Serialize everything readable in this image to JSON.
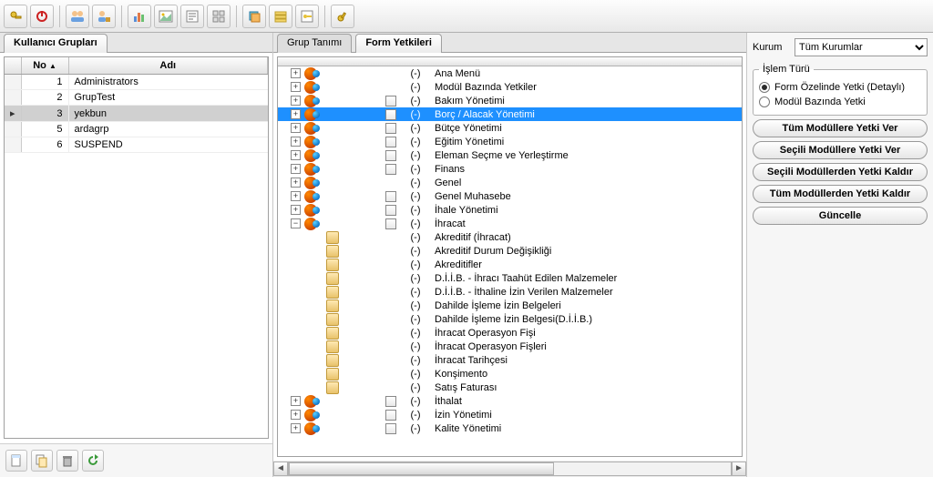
{
  "toolbar_icons": [
    "key-icon",
    "power-icon",
    "users-icon",
    "user-lock-icon",
    "chart-icon",
    "image-icon",
    "form-icon",
    "grid-icon",
    "sep",
    "layers-icon",
    "stack-icon",
    "key2-icon",
    "key3-icon"
  ],
  "left": {
    "tab": "Kullanıcı Grupları",
    "cols": {
      "rowhead": "",
      "no": "No",
      "name": "Adı"
    },
    "rows": [
      {
        "no": 1,
        "name": "Administrators",
        "sel": false
      },
      {
        "no": 2,
        "name": "GrupTest",
        "sel": false
      },
      {
        "no": 3,
        "name": "yekbun",
        "sel": true
      },
      {
        "no": 5,
        "name": "ardagrp",
        "sel": false
      },
      {
        "no": 6,
        "name": "SUSPEND",
        "sel": false
      }
    ],
    "bottom_icons": [
      "new-doc-icon",
      "copy-doc-icon",
      "delete-icon",
      "refresh-icon"
    ]
  },
  "center": {
    "tab_inactive": "Grup Tanımı",
    "tab_active": "Form Yetkileri",
    "tree": [
      {
        "depth": 0,
        "toggle": "plus",
        "ico": "node",
        "chk": false,
        "dash": "(-)",
        "label": "Ana Menü",
        "sel": false
      },
      {
        "depth": 0,
        "toggle": "plus",
        "ico": "node",
        "chk": false,
        "dash": "(-)",
        "label": "Modül Bazında Yetkiler",
        "sel": false
      },
      {
        "depth": 0,
        "toggle": "plus",
        "ico": "node",
        "chk": true,
        "dash": "(-)",
        "label": "Bakım Yönetimi",
        "sel": false
      },
      {
        "depth": 0,
        "toggle": "plus",
        "ico": "node",
        "chk": true,
        "dash": "(-)",
        "label": "Borç / Alacak Yönetimi",
        "sel": true
      },
      {
        "depth": 0,
        "toggle": "plus",
        "ico": "node",
        "chk": true,
        "dash": "(-)",
        "label": "Bütçe Yönetimi",
        "sel": false
      },
      {
        "depth": 0,
        "toggle": "plus",
        "ico": "node",
        "chk": true,
        "dash": "(-)",
        "label": "Eğitim Yönetimi",
        "sel": false
      },
      {
        "depth": 0,
        "toggle": "plus",
        "ico": "node",
        "chk": true,
        "dash": "(-)",
        "label": "Eleman Seçme ve Yerleştirme",
        "sel": false
      },
      {
        "depth": 0,
        "toggle": "plus",
        "ico": "node",
        "chk": true,
        "dash": "(-)",
        "label": "Finans",
        "sel": false
      },
      {
        "depth": 0,
        "toggle": "plus",
        "ico": "node",
        "chk": false,
        "dash": "(-)",
        "label": "Genel",
        "sel": false
      },
      {
        "depth": 0,
        "toggle": "plus",
        "ico": "node",
        "chk": true,
        "dash": "(-)",
        "label": "Genel Muhasebe",
        "sel": false
      },
      {
        "depth": 0,
        "toggle": "plus",
        "ico": "node",
        "chk": true,
        "dash": "(-)",
        "label": "İhale Yönetimi",
        "sel": false
      },
      {
        "depth": 0,
        "toggle": "minus",
        "ico": "node",
        "chk": true,
        "dash": "(-)",
        "label": "İhracat",
        "sel": false
      },
      {
        "depth": 1,
        "toggle": "",
        "ico": "leaf",
        "chk": false,
        "dash": "(-)",
        "label": "Akreditif (İhracat)",
        "sel": false
      },
      {
        "depth": 1,
        "toggle": "",
        "ico": "leaf",
        "chk": false,
        "dash": "(-)",
        "label": "Akreditif Durum Değişikliği",
        "sel": false
      },
      {
        "depth": 1,
        "toggle": "",
        "ico": "leaf",
        "chk": false,
        "dash": "(-)",
        "label": "Akreditifler",
        "sel": false
      },
      {
        "depth": 1,
        "toggle": "",
        "ico": "leaf",
        "chk": false,
        "dash": "(-)",
        "label": "D.İ.İ.B. - İhracı Taahüt Edilen Malzemeler",
        "sel": false
      },
      {
        "depth": 1,
        "toggle": "",
        "ico": "leaf",
        "chk": false,
        "dash": "(-)",
        "label": "D.İ.İ.B. - İthaline İzin Verilen Malzemeler",
        "sel": false
      },
      {
        "depth": 1,
        "toggle": "",
        "ico": "leaf",
        "chk": false,
        "dash": "(-)",
        "label": "Dahilde İşleme İzin Belgeleri",
        "sel": false
      },
      {
        "depth": 1,
        "toggle": "",
        "ico": "leaf",
        "chk": false,
        "dash": "(-)",
        "label": "Dahilde İşleme İzin Belgesi(D.İ.İ.B.)",
        "sel": false
      },
      {
        "depth": 1,
        "toggle": "",
        "ico": "leaf",
        "chk": false,
        "dash": "(-)",
        "label": "İhracat Operasyon Fişi",
        "sel": false
      },
      {
        "depth": 1,
        "toggle": "",
        "ico": "leaf",
        "chk": false,
        "dash": "(-)",
        "label": "İhracat Operasyon Fişleri",
        "sel": false
      },
      {
        "depth": 1,
        "toggle": "",
        "ico": "leaf",
        "chk": false,
        "dash": "(-)",
        "label": "İhracat Tarihçesi",
        "sel": false
      },
      {
        "depth": 1,
        "toggle": "",
        "ico": "leaf",
        "chk": false,
        "dash": "(-)",
        "label": "Konşimento",
        "sel": false
      },
      {
        "depth": 1,
        "toggle": "",
        "ico": "leaf",
        "chk": false,
        "dash": "(-)",
        "label": "Satış Faturası",
        "sel": false
      },
      {
        "depth": 0,
        "toggle": "plus",
        "ico": "node",
        "chk": true,
        "dash": "(-)",
        "label": "İthalat",
        "sel": false
      },
      {
        "depth": 0,
        "toggle": "plus",
        "ico": "node",
        "chk": true,
        "dash": "(-)",
        "label": "İzin Yönetimi",
        "sel": false
      },
      {
        "depth": 0,
        "toggle": "plus",
        "ico": "node",
        "chk": true,
        "dash": "(-)",
        "label": "Kalite Yönetimi",
        "sel": false
      }
    ]
  },
  "right": {
    "kurum_label": "Kurum",
    "kurum_value": "Tüm Kurumlar",
    "islem_label": "İşlem Türü",
    "radio1": "Form Özelinde Yetki (Detaylı)",
    "radio2": "Modül Bazında Yetki",
    "btn1": "Tüm Modüllere Yetki Ver",
    "btn2": "Seçili Modüllere Yetki Ver",
    "btn3": "Seçili Modüllerden Yetki Kaldır",
    "btn4": "Tüm Modüllerden Yetki Kaldır",
    "btn5": "Güncelle"
  }
}
